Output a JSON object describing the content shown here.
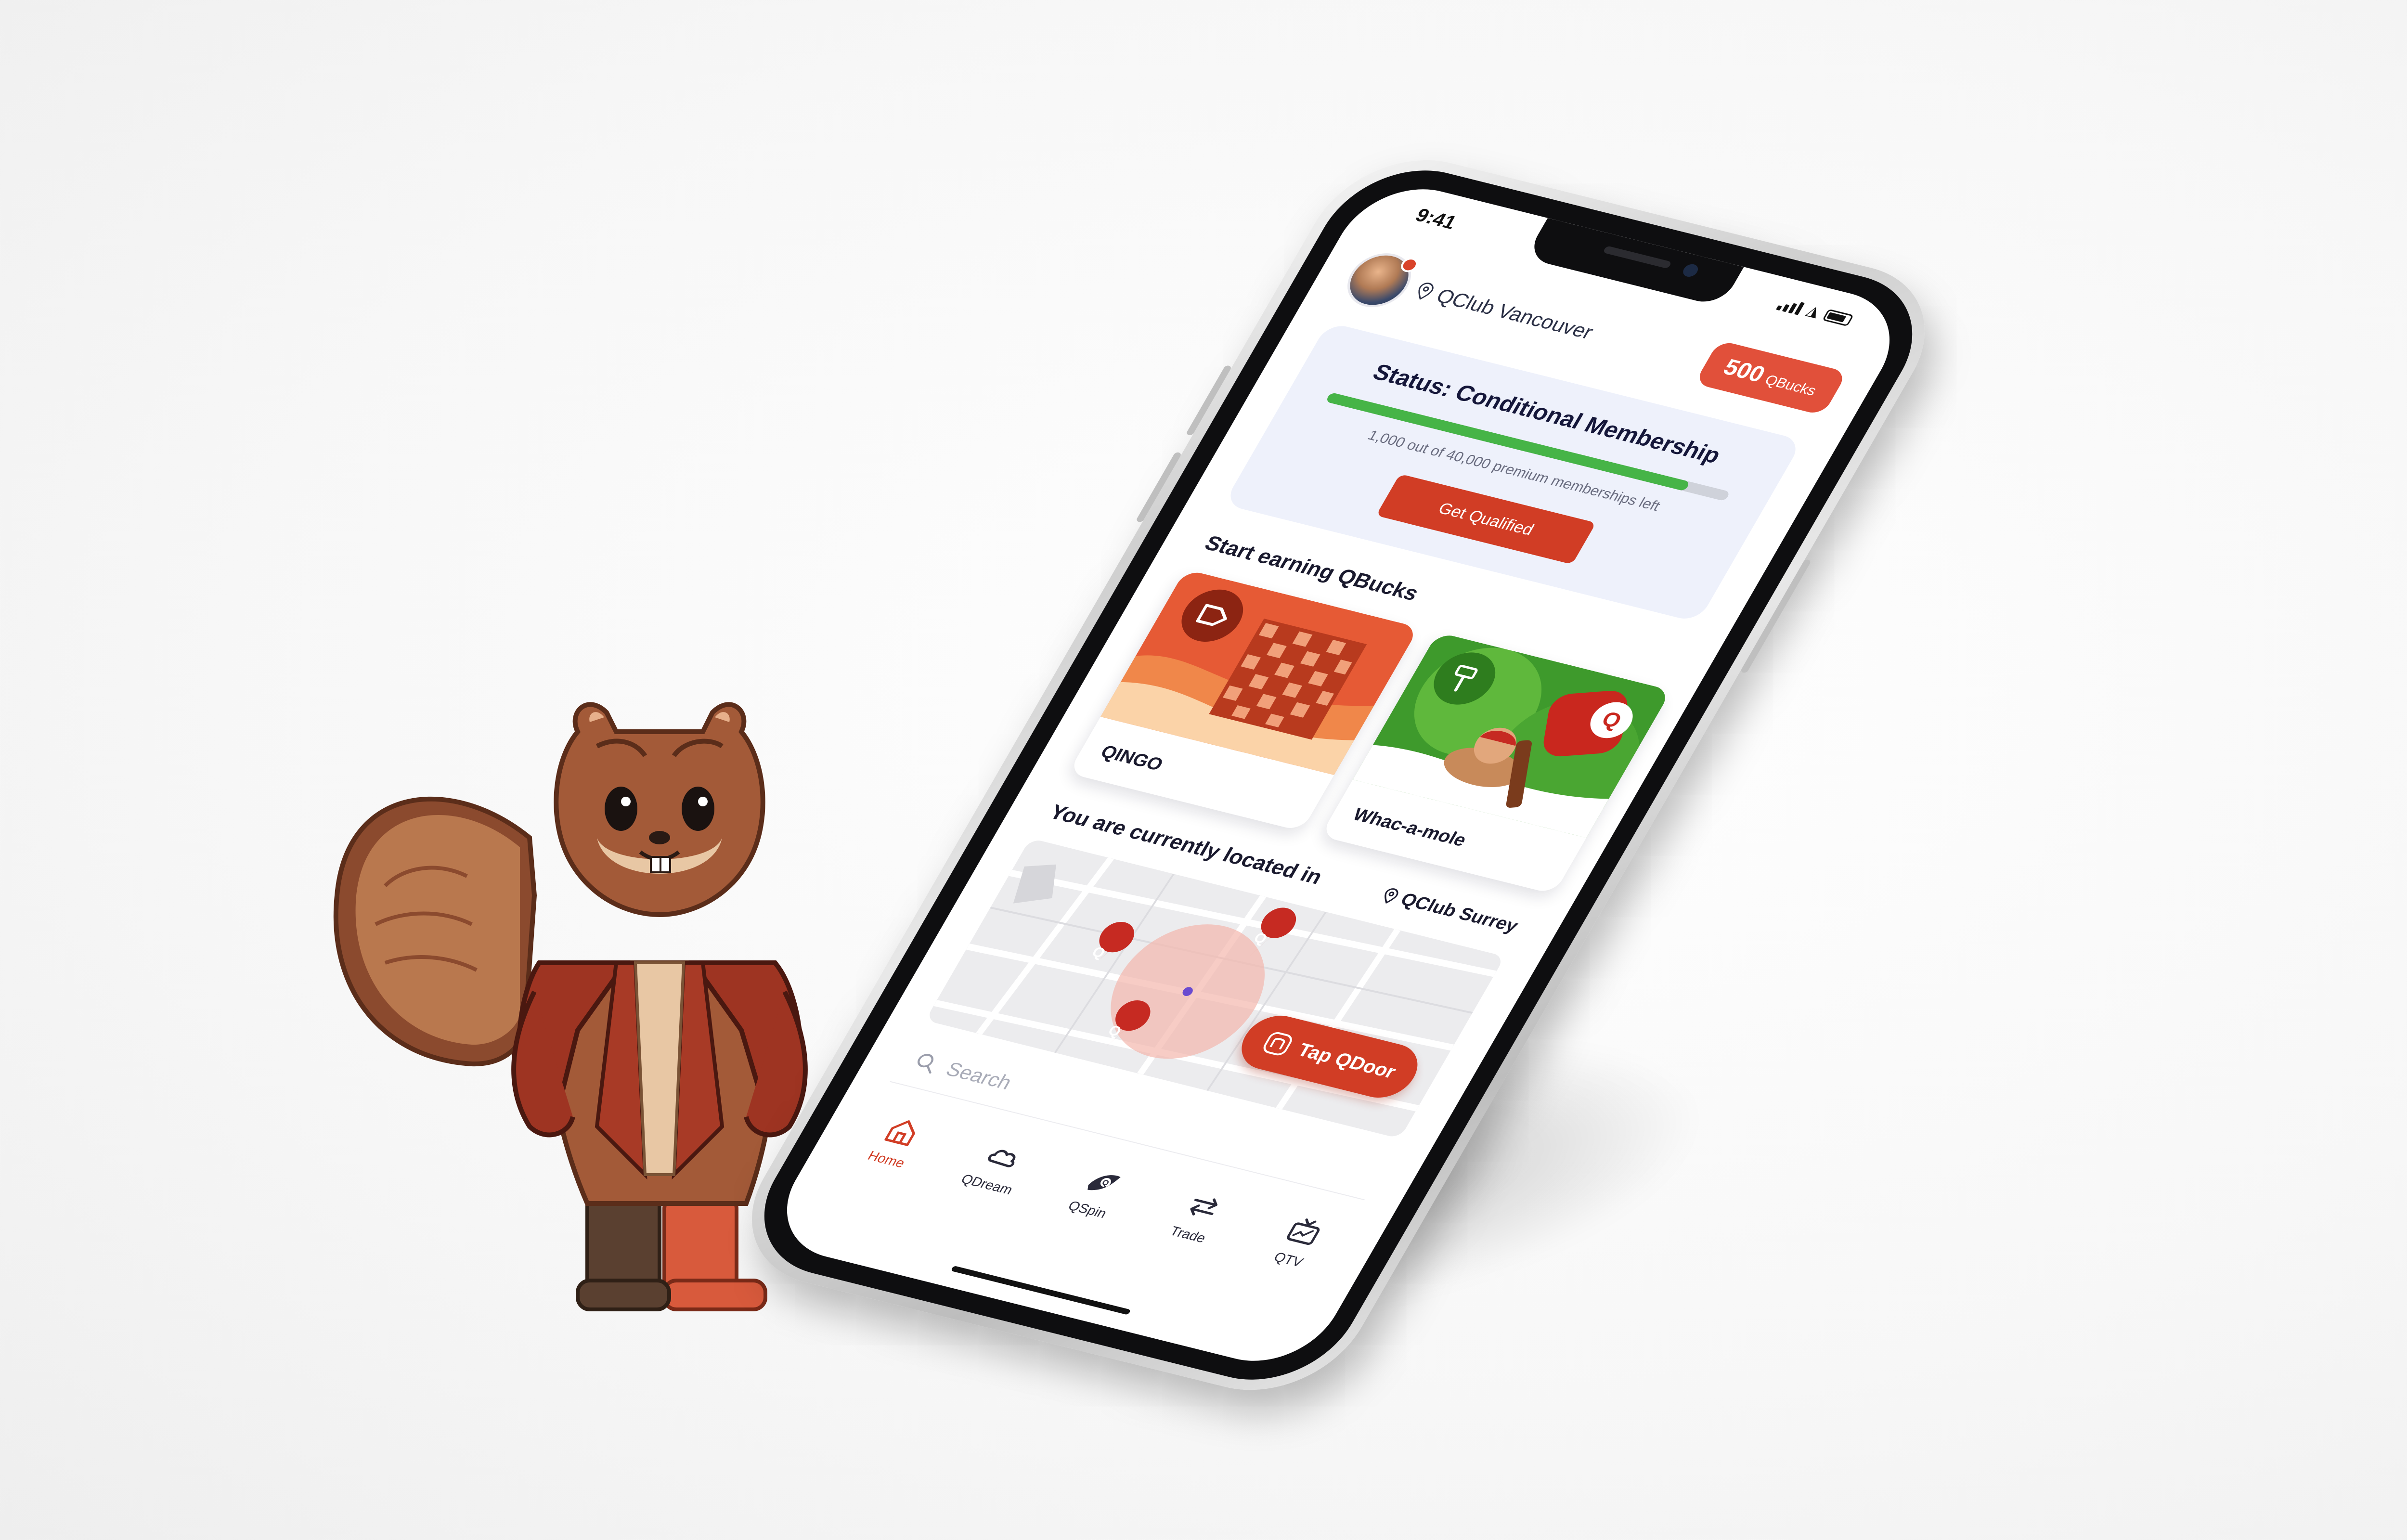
{
  "status_bar": {
    "time": "9:41"
  },
  "header": {
    "location": "QClub Vancouver",
    "qbucks_amount": "500",
    "qbucks_unit": "QBucks"
  },
  "membership": {
    "title": "Status: Conditional Membership",
    "caption": "1,000 out of 40,000 premium memberships left",
    "progress_fraction": 0.9,
    "button_label": "Get Qualified"
  },
  "earn": {
    "title": "Start earning QBucks",
    "games": [
      {
        "label": "QINGO",
        "icon": "tag-icon"
      },
      {
        "label": "Whac-a-mole",
        "icon": "hammer-icon"
      }
    ]
  },
  "location": {
    "title": "You are currently located in",
    "current_club": "QClub Surrey",
    "cta_label": "Tap QDoor"
  },
  "search": {
    "placeholder": "Search"
  },
  "nav": {
    "items": [
      {
        "label": "Home",
        "icon": "home-icon"
      },
      {
        "label": "QDream",
        "icon": "cloud-icon"
      },
      {
        "label": "QSpin",
        "icon": "spin-icon"
      },
      {
        "label": "Trade",
        "icon": "swap-icon"
      },
      {
        "label": "QTV",
        "icon": "tv-icon"
      }
    ]
  },
  "colors": {
    "accent": "#d13d25",
    "qbucks_button": "#e1503a",
    "progress": "#46b447",
    "card_bg": "#eef1fb",
    "text_dark": "#15173a"
  }
}
